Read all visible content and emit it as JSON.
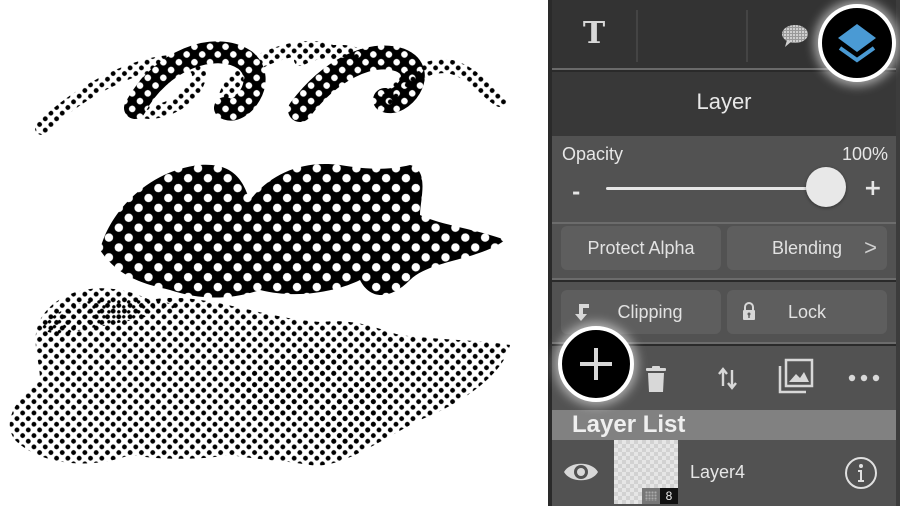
{
  "toolbar": {
    "text_tool_glyph": "T",
    "tools": [
      "text-tool",
      "empty-slot",
      "speech-bubble-tool",
      "layers-tool"
    ]
  },
  "panel": {
    "title": "Layer",
    "opacity": {
      "label": "Opacity",
      "value_text": "100%",
      "value": 100,
      "minus": "-",
      "plus": "+"
    },
    "buttons": {
      "protect_alpha": "Protect Alpha",
      "blending": "Blending",
      "blending_chevron": ">",
      "clipping": "Clipping",
      "lock": "Lock"
    },
    "actions": [
      "add-layer",
      "delete-layer",
      "move-layer",
      "import-image",
      "more-options"
    ],
    "list_header": "Layer List",
    "layers": [
      {
        "name": "Layer4",
        "visible": true,
        "badge": "8"
      }
    ]
  },
  "colors": {
    "accent_blue": "#4a9ad4",
    "panel_bg": "#525252",
    "header_bg": "#383838",
    "list_header_bg": "#818181"
  }
}
